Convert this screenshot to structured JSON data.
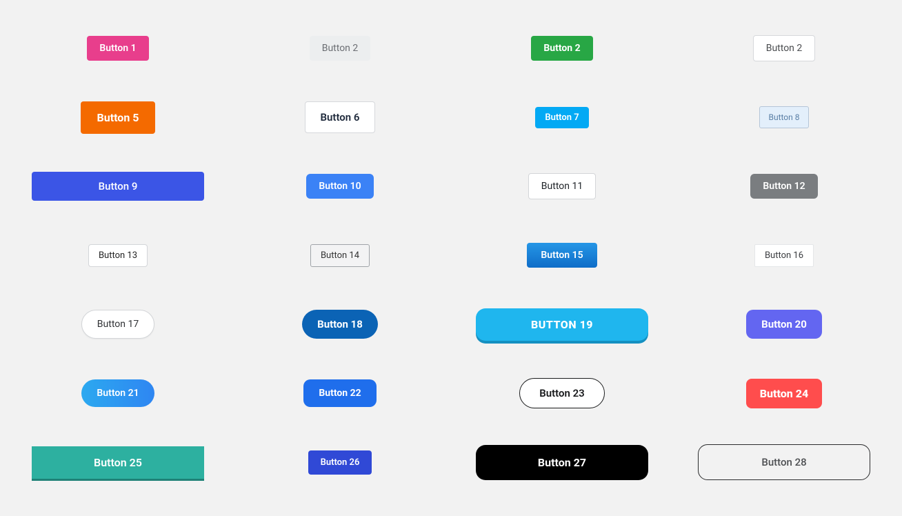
{
  "buttons": {
    "b1": "Button 1",
    "b2": "Button 2",
    "b3": "Button 2",
    "b4": "Button 2",
    "b5": "Button 5",
    "b6": "Button 6",
    "b7": "Button 7",
    "b8": "Button 8",
    "b9": "Button 9",
    "b10": "Button 10",
    "b11": "Button 11",
    "b12": "Button 12",
    "b13": "Button 13",
    "b14": "Button 14",
    "b15": "Button 15",
    "b16": "Button 16",
    "b17": "Button 17",
    "b18": "Button 18",
    "b19": "BUTTON 19",
    "b20": "Button 20",
    "b21": "Button 21",
    "b22": "Button 22",
    "b23": "Button 23",
    "b24": "Button 24",
    "b25": "Button 25",
    "b26": "Button 26",
    "b27": "Button 27",
    "b28": "Button 28"
  }
}
